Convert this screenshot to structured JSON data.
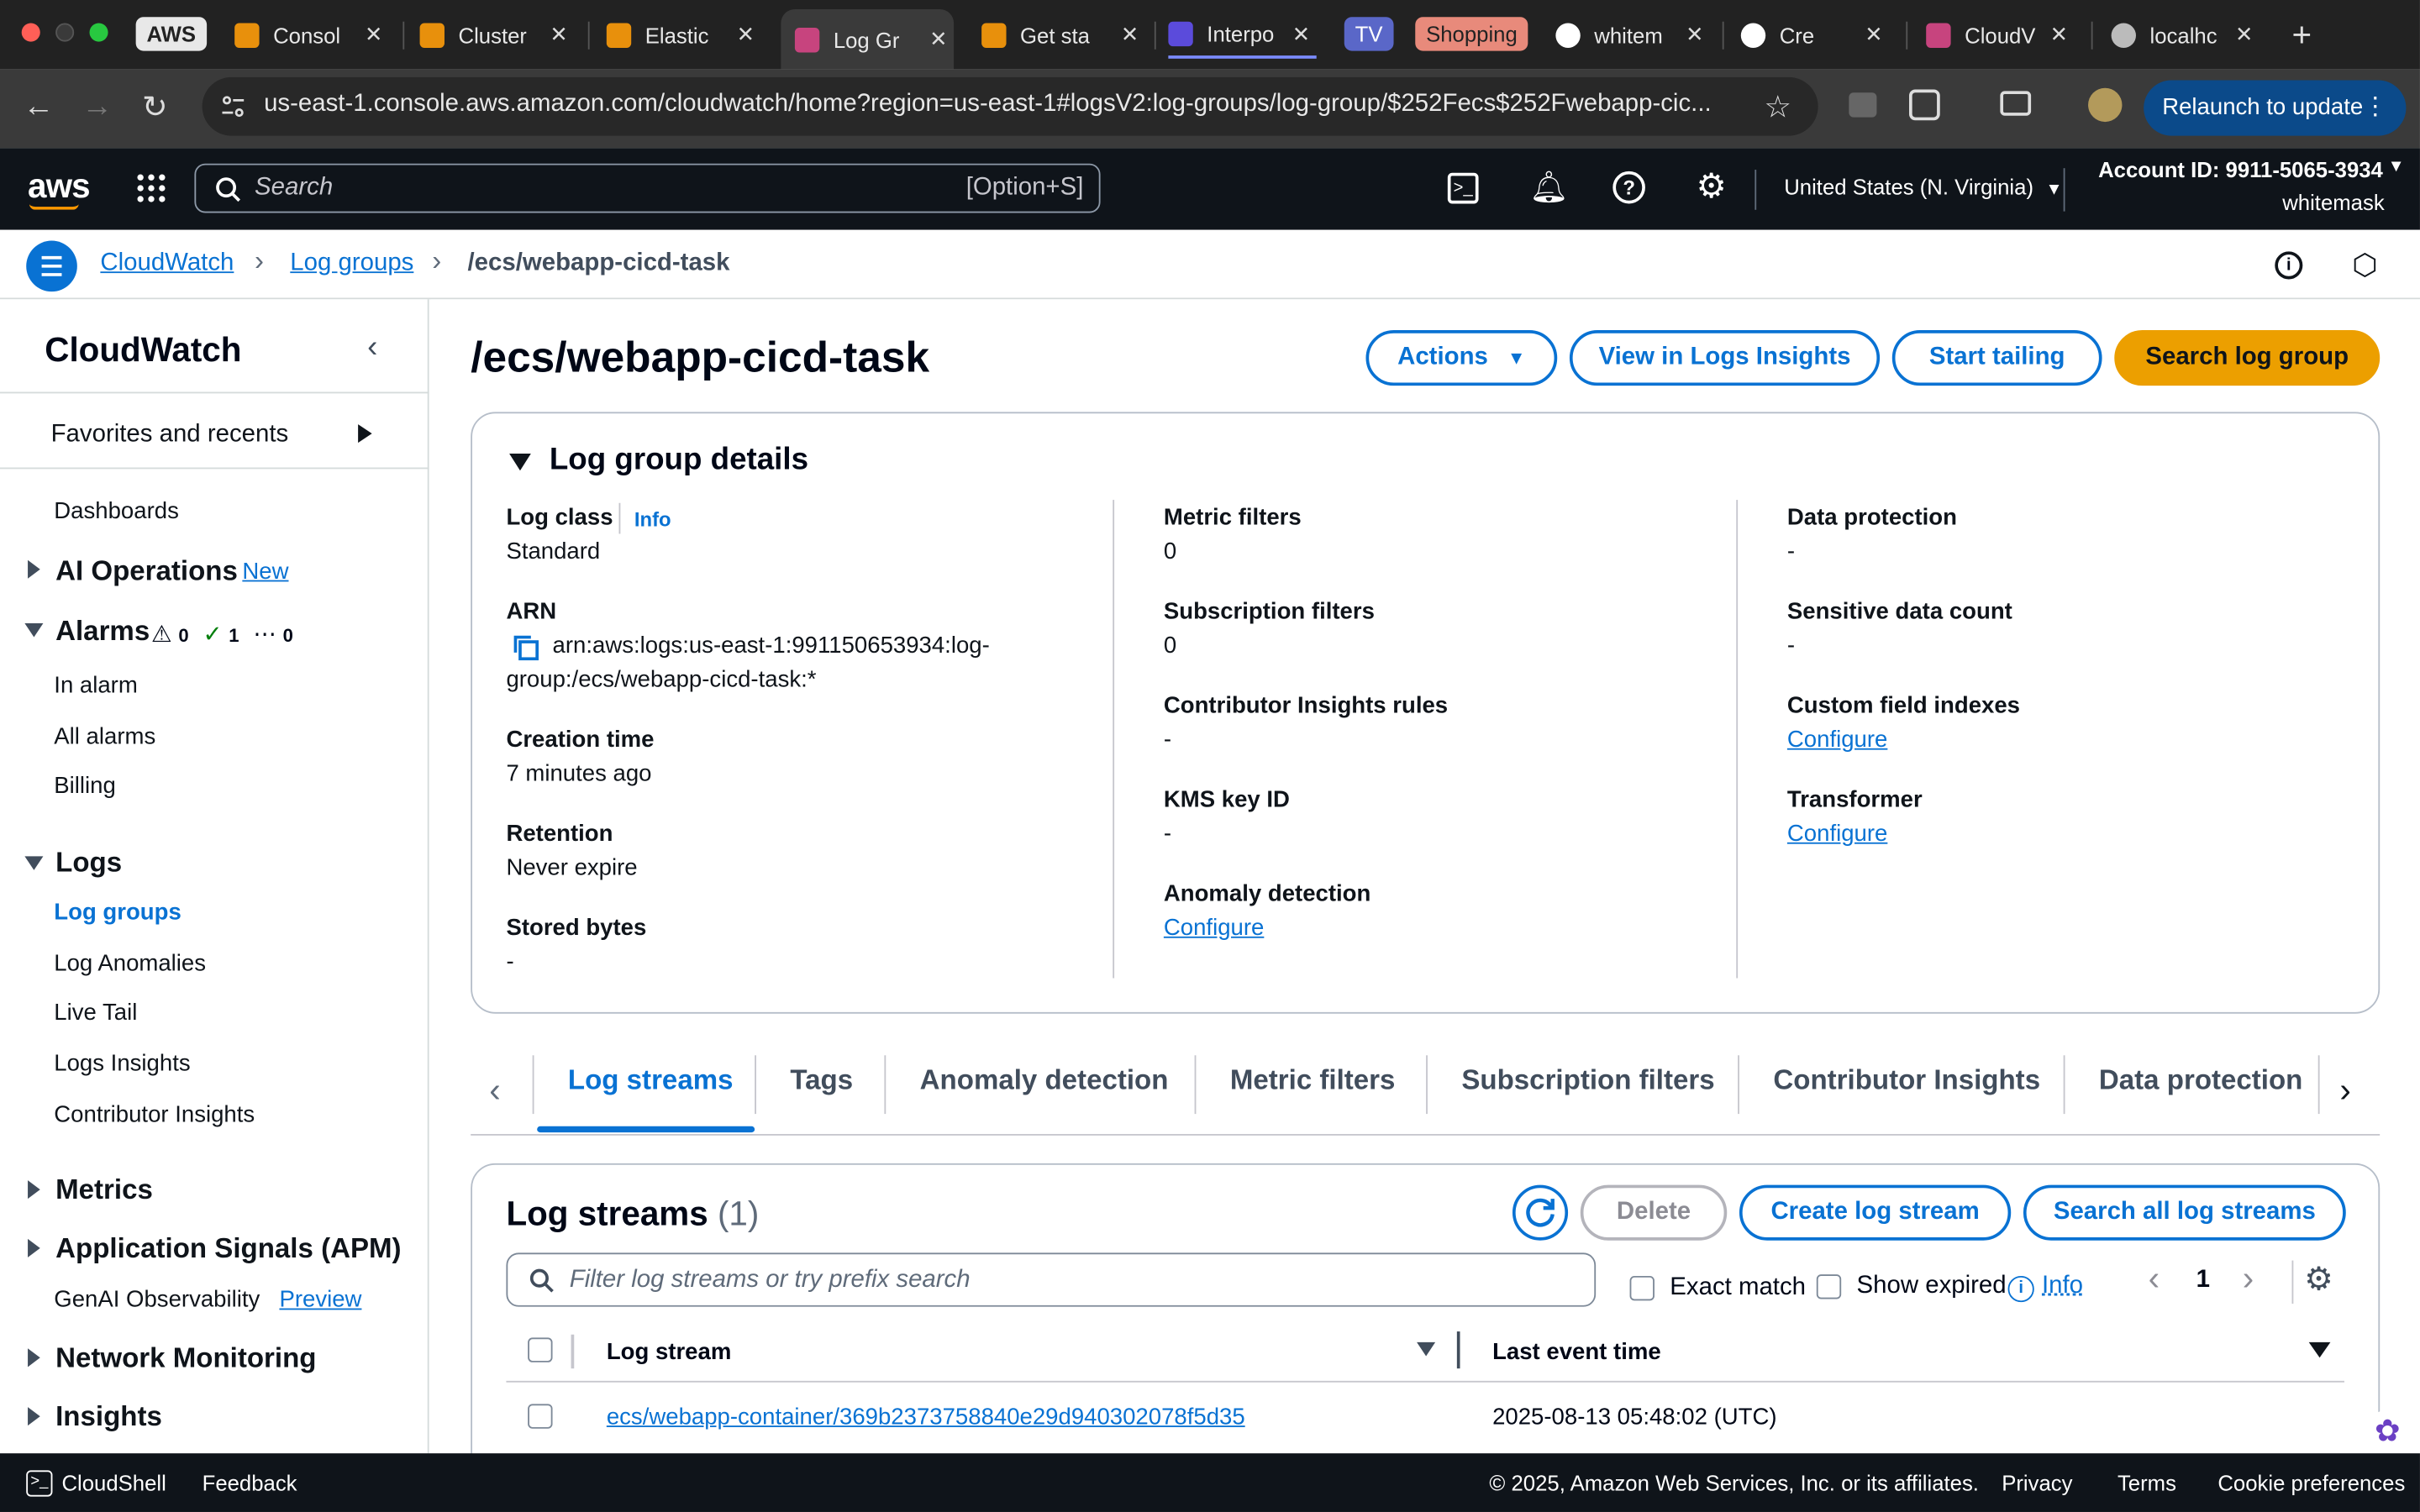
{
  "browser": {
    "tabs": [
      {
        "label": "AWS"
      },
      {
        "label": "Consol"
      },
      {
        "label": "Cluster"
      },
      {
        "label": "Elastic"
      },
      {
        "label": "Log Gr"
      },
      {
        "label": "Get sta"
      },
      {
        "label": "Interpo"
      },
      {
        "label": "TV"
      },
      {
        "label": "Shopping"
      },
      {
        "label": "whitem"
      },
      {
        "label": "Cre"
      },
      {
        "label": "CloudV"
      },
      {
        "label": "localhc"
      }
    ],
    "url": "us-east-1.console.aws.amazon.com/cloudwatch/home?region=us-east-1#logsV2:log-groups/log-group/$252Fecs$252Fwebapp-cic...",
    "relaunch_label": "Relaunch to update"
  },
  "aws_nav": {
    "logo": "aws",
    "search_placeholder": "Search",
    "search_shortcut": "[Option+S]",
    "region": "United States (N. Virginia)",
    "account_id": "Account ID: 9911-5065-3934",
    "user": "whitemask"
  },
  "breadcrumb": {
    "items": [
      "CloudWatch",
      "Log groups",
      "/ecs/webapp-cicd-task"
    ]
  },
  "sidebar": {
    "title": "CloudWatch",
    "favorites": "Favorites and recents",
    "dashboards": "Dashboards",
    "ai_operations": "AI Operations",
    "ai_badge": "New",
    "alarms": "Alarms",
    "alarm_counts": {
      "warning": "0",
      "ok": "1",
      "insufficient": "0"
    },
    "alarm_items": [
      "In alarm",
      "All alarms",
      "Billing"
    ],
    "logs": "Logs",
    "log_items": [
      "Log groups",
      "Log Anomalies",
      "Live Tail",
      "Logs Insights",
      "Contributor Insights"
    ],
    "metrics": "Metrics",
    "app_signals": "Application Signals (APM)",
    "genai": "GenAI Observability",
    "genai_badge": "Preview",
    "network": "Network Monitoring",
    "insights": "Insights"
  },
  "page": {
    "title": "/ecs/webapp-cicd-task",
    "buttons": {
      "actions": "Actions",
      "view_insights": "View in Logs Insights",
      "start_tailing": "Start tailing",
      "search_group": "Search log group"
    }
  },
  "details": {
    "heading": "Log group details",
    "log_class_label": "Log class",
    "info": "Info",
    "log_class_value": "Standard",
    "arn_label": "ARN",
    "arn_line1": "arn:aws:logs:us-east-1:991150653934:log-",
    "arn_line2": "group:/ecs/webapp-cicd-task:*",
    "creation_label": "Creation time",
    "creation_value": "7 minutes ago",
    "retention_label": "Retention",
    "retention_value": "Never expire",
    "stored_label": "Stored bytes",
    "stored_value": "-",
    "metric_filters_label": "Metric filters",
    "metric_filters_value": "0",
    "subscription_label": "Subscription filters",
    "subscription_value": "0",
    "contrib_label": "Contributor Insights rules",
    "contrib_value": "-",
    "kms_label": "KMS key ID",
    "kms_value": "-",
    "anomaly_label": "Anomaly detection",
    "anomaly_link": "Configure",
    "data_protection_label": "Data protection",
    "data_protection_value": "-",
    "sensitive_label": "Sensitive data count",
    "sensitive_value": "-",
    "custom_index_label": "Custom field indexes",
    "custom_index_link": "Configure",
    "transformer_label": "Transformer",
    "transformer_link": "Configure"
  },
  "tabs": [
    "Log streams",
    "Tags",
    "Anomaly detection",
    "Metric filters",
    "Subscription filters",
    "Contributor Insights",
    "Data protection"
  ],
  "streams": {
    "heading": "Log streams",
    "count": "(1)",
    "delete": "Delete",
    "create": "Create log stream",
    "search_all": "Search all log streams",
    "filter_placeholder": "Filter log streams or try prefix search",
    "exact_match": "Exact match",
    "show_expired": "Show expired",
    "info": "Info",
    "page": "1",
    "col_stream": "Log stream",
    "col_time": "Last event time",
    "rows": [
      {
        "name": "ecs/webapp-container/369b2373758840e29d940302078f5d35",
        "time": "2025-08-13 05:48:02 (UTC)"
      }
    ]
  },
  "footer": {
    "cloudshell": "CloudShell",
    "feedback": "Feedback",
    "copyright": "© 2025, Amazon Web Services, Inc. or its affiliates.",
    "privacy": "Privacy",
    "terms": "Terms",
    "cookies": "Cookie preferences"
  },
  "colors": {
    "nav_bg": "#0f141a",
    "link": "#0972d3",
    "primary": "#ec9f00"
  }
}
